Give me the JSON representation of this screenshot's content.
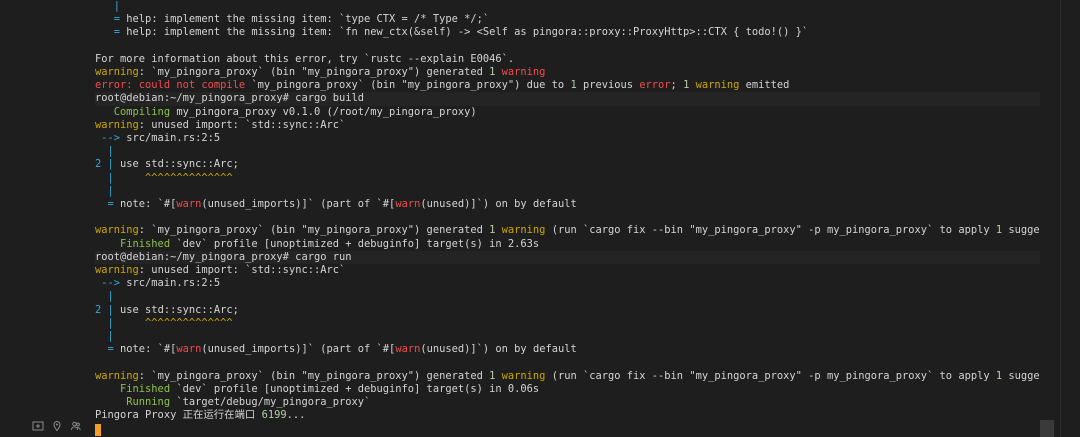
{
  "colors": {
    "background": "#1e1e1e",
    "text": "#d4d4d4",
    "yellow": "#cca700",
    "red": "#f14c4c",
    "cyan": "#3aa9d6",
    "green": "#8dc24a",
    "number": "#b5cea8",
    "cursor": "#f4a12b"
  },
  "icons": [
    "new-tab-icon",
    "location-pin-icon",
    "people-icon"
  ],
  "lines": [
    [
      {
        "t": "   |",
        "c": "cyan"
      }
    ],
    [
      {
        "t": "   = ",
        "c": "cyan"
      },
      {
        "t": "help",
        "c": "text"
      },
      {
        "t": ": implement the missing item: `type CTX = /* Type */;`",
        "c": "text"
      }
    ],
    [
      {
        "t": "   = ",
        "c": "cyan"
      },
      {
        "t": "help",
        "c": "text"
      },
      {
        "t": ": implement the missing item: `fn new_ctx(&self) -> <Self as pingora::proxy::ProxyHttp>::CTX { todo!() }`",
        "c": "text"
      }
    ],
    [
      {
        "t": "",
        "c": "text"
      }
    ],
    [
      {
        "t": "For more information about this error, try `rustc --explain E0046`.",
        "c": "text"
      }
    ],
    [
      {
        "t": "warning",
        "c": "yellow"
      },
      {
        "t": ": `my_pingora_proxy` (bin \"my_pingora_proxy\") generated ",
        "c": "text"
      },
      {
        "t": "1",
        "c": "number"
      },
      {
        "t": " warning",
        "c": "red"
      }
    ],
    [
      {
        "t": "error: could not compile",
        "c": "red"
      },
      {
        "t": " `my_pingora_proxy` (bin \"my_pingora_proxy\") due to ",
        "c": "text"
      },
      {
        "t": "1",
        "c": "number"
      },
      {
        "t": " previous ",
        "c": "text"
      },
      {
        "t": "error",
        "c": "red"
      },
      {
        "t": "; ",
        "c": "text"
      },
      {
        "t": "1",
        "c": "number"
      },
      {
        "t": " ",
        "c": "text"
      },
      {
        "t": "warning",
        "c": "yellow"
      },
      {
        "t": " emitted",
        "c": "text"
      }
    ],
    [
      {
        "t": "root@debian:~/my_pingora_proxy# cargo build",
        "c": "text",
        "cmd": true
      }
    ],
    [
      {
        "t": "   Compiling",
        "c": "green"
      },
      {
        "t": " my_pingora_proxy v0.1.0 (/root/my_pingora_proxy)",
        "c": "text"
      }
    ],
    [
      {
        "t": "warning",
        "c": "yellow"
      },
      {
        "t": ": unused import: `std::sync::Arc`",
        "c": "text"
      }
    ],
    [
      {
        "t": " --> ",
        "c": "cyan"
      },
      {
        "t": "src/main.rs:2:5",
        "c": "text"
      }
    ],
    [
      {
        "t": "  |",
        "c": "cyan"
      }
    ],
    [
      {
        "t": "2 | ",
        "c": "cyan"
      },
      {
        "t": "use std::sync::Arc;",
        "c": "text"
      }
    ],
    [
      {
        "t": "  |     ",
        "c": "cyan"
      },
      {
        "t": "^^^^^^^^^^^^^^",
        "c": "yellow"
      }
    ],
    [
      {
        "t": "  |",
        "c": "cyan"
      }
    ],
    [
      {
        "t": "  = ",
        "c": "cyan"
      },
      {
        "t": "note",
        "c": "text"
      },
      {
        "t": ": `#[",
        "c": "text"
      },
      {
        "t": "warn",
        "c": "red"
      },
      {
        "t": "(unused_imports)]` (part of `#[",
        "c": "text"
      },
      {
        "t": "warn",
        "c": "red"
      },
      {
        "t": "(unused)]`) on by default",
        "c": "text"
      }
    ],
    [
      {
        "t": "",
        "c": "text"
      }
    ],
    [
      {
        "t": "warning",
        "c": "yellow"
      },
      {
        "t": ": `my_pingora_proxy` (bin \"my_pingora_proxy\") generated ",
        "c": "text"
      },
      {
        "t": "1",
        "c": "number"
      },
      {
        "t": " warning",
        "c": "yellow"
      },
      {
        "t": " (run `cargo fix --bin \"my_pingora_proxy\" -p my_pingora_proxy` to apply ",
        "c": "text"
      },
      {
        "t": "1",
        "c": "number"
      },
      {
        "t": " suggestion)",
        "c": "text"
      }
    ],
    [
      {
        "t": "    Finished",
        "c": "green"
      },
      {
        "t": " `dev` profile [unoptimized + debuginfo] target(s) in 2.63s",
        "c": "text"
      }
    ],
    [
      {
        "t": "root@debian:~/my_pingora_proxy# cargo run",
        "c": "text",
        "cmd": true
      }
    ],
    [
      {
        "t": "warning",
        "c": "yellow"
      },
      {
        "t": ": unused import: `std::sync::Arc`",
        "c": "text"
      }
    ],
    [
      {
        "t": " --> ",
        "c": "cyan"
      },
      {
        "t": "src/main.rs:2:5",
        "c": "text"
      }
    ],
    [
      {
        "t": "  |",
        "c": "cyan"
      }
    ],
    [
      {
        "t": "2 | ",
        "c": "cyan"
      },
      {
        "t": "use std::sync::Arc;",
        "c": "text"
      }
    ],
    [
      {
        "t": "  |     ",
        "c": "cyan"
      },
      {
        "t": "^^^^^^^^^^^^^^",
        "c": "yellow"
      }
    ],
    [
      {
        "t": "  |",
        "c": "cyan"
      }
    ],
    [
      {
        "t": "  = ",
        "c": "cyan"
      },
      {
        "t": "note",
        "c": "text"
      },
      {
        "t": ": `#[",
        "c": "text"
      },
      {
        "t": "warn",
        "c": "red"
      },
      {
        "t": "(unused_imports)]` (part of `#[",
        "c": "text"
      },
      {
        "t": "warn",
        "c": "red"
      },
      {
        "t": "(unused)]`) on by default",
        "c": "text"
      }
    ],
    [
      {
        "t": "",
        "c": "text"
      }
    ],
    [
      {
        "t": "warning",
        "c": "yellow"
      },
      {
        "t": ": `my_pingora_proxy` (bin \"my_pingora_proxy\") generated ",
        "c": "text"
      },
      {
        "t": "1",
        "c": "number"
      },
      {
        "t": " warning",
        "c": "yellow"
      },
      {
        "t": " (run `cargo fix --bin \"my_pingora_proxy\" -p my_pingora_proxy` to apply ",
        "c": "text"
      },
      {
        "t": "1",
        "c": "number"
      },
      {
        "t": " suggestion)",
        "c": "text"
      }
    ],
    [
      {
        "t": "    Finished",
        "c": "green"
      },
      {
        "t": " `dev` profile [unoptimized + debuginfo] target(s) in 0.06s",
        "c": "text"
      }
    ],
    [
      {
        "t": "     Running",
        "c": "green"
      },
      {
        "t": " `target/debug/my_pingora_proxy`",
        "c": "text"
      }
    ],
    [
      {
        "t": "Pingora Proxy 正在运行在端口 ",
        "c": "text"
      },
      {
        "t": "6199",
        "c": "number"
      },
      {
        "t": "...",
        "c": "text"
      }
    ]
  ]
}
